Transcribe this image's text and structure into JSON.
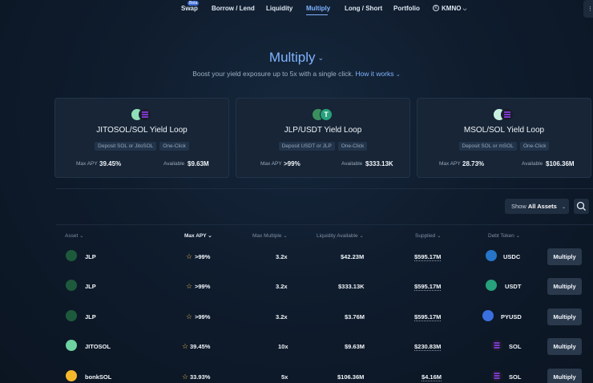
{
  "nav": {
    "items": [
      {
        "label": "Swap",
        "badge": "Beta"
      },
      {
        "label": "Borrow / Lend"
      },
      {
        "label": "Liquidity"
      },
      {
        "label": "Multiply",
        "active": true
      },
      {
        "label": "Long / Short"
      },
      {
        "label": "Portfolio"
      },
      {
        "label": "KMNO"
      }
    ]
  },
  "hero": {
    "title": "Multiply",
    "subtitle": "Boost your yield exposure up to 5x with a single click.",
    "link": "How it works"
  },
  "cards": [
    {
      "title": "JITOSOL/SOL Yield Loop",
      "tags": [
        "Deposit SOL or JitoSOL",
        "One-Click"
      ],
      "apy_label": "Max APY",
      "apy": "39.45%",
      "avail_label": "Available",
      "available": "$9.63M"
    },
    {
      "title": "JLP/USDT Yield Loop",
      "tags": [
        "Deposit USDT or JLP",
        "One-Click"
      ],
      "apy_label": "Max APY",
      "apy": ">99%",
      "avail_label": "Available",
      "available": "$333.13K"
    },
    {
      "title": "MSOL/SOL Yield Loop",
      "tags": [
        "Deposit SOL or mSOL",
        "One-Click"
      ],
      "apy_label": "Max APY",
      "apy": "28.73%",
      "avail_label": "Available",
      "available": "$106.36M"
    }
  ],
  "filter": {
    "prefix": "Show",
    "value": "All Assets"
  },
  "table": {
    "headers": {
      "asset": "Asset",
      "max_apy": "Max APY",
      "max_multiple": "Max Multiple",
      "liquidity": "Liquidity Available",
      "supplied": "Supplied",
      "debt": "Debt Token"
    },
    "rows": [
      {
        "asset": "JLP",
        "apy": ">99%",
        "multiple": "3.2x",
        "liquidity": "$42.23M",
        "supplied": "$595.17M",
        "debt": "USDC",
        "action": "Multiply"
      },
      {
        "asset": "JLP",
        "apy": ">99%",
        "multiple": "3.2x",
        "liquidity": "$333.13K",
        "supplied": "$595.17M",
        "debt": "USDT",
        "action": "Multiply"
      },
      {
        "asset": "JLP",
        "apy": ">99%",
        "multiple": "3.2x",
        "liquidity": "$3.76M",
        "supplied": "$595.17M",
        "debt": "PYUSD",
        "action": "Multiply"
      },
      {
        "asset": "JITOSOL",
        "apy": "39.45%",
        "multiple": "10x",
        "liquidity": "$9.63M",
        "supplied": "$230.83M",
        "debt": "SOL",
        "action": "Multiply"
      },
      {
        "asset": "bonkSOL",
        "apy": "33.93%",
        "multiple": "5x",
        "liquidity": "$106.36M",
        "supplied": "$4.16M",
        "debt": "SOL",
        "action": "Multiply"
      }
    ]
  },
  "colors": {
    "accent": "#7fb3ff",
    "star": "#e4b84b",
    "background": "#0f1c2d"
  }
}
